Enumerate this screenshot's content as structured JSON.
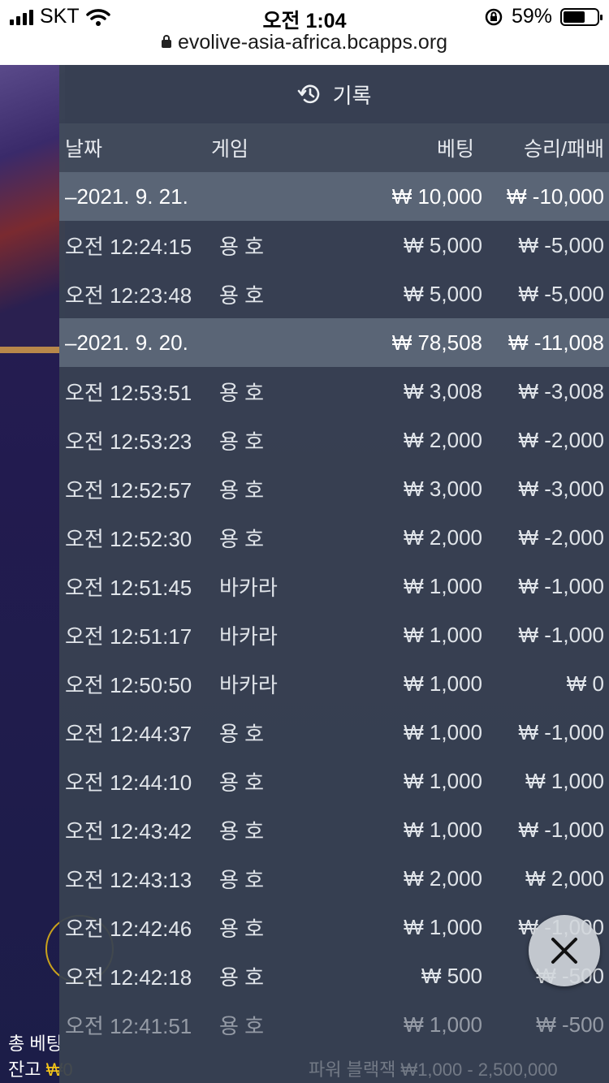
{
  "status_bar": {
    "carrier": "SKT",
    "time": "오전 1:04",
    "battery": "59%",
    "url": "evolive-asia-africa.bcapps.org"
  },
  "panel": {
    "title": "기록",
    "columns": {
      "date": "날짜",
      "game": "게임",
      "bet": "베팅",
      "winloss": "승리/패배"
    },
    "groups": [
      {
        "date": "–2021. 9. 21.",
        "bet": "₩ 10,000",
        "winloss": "₩ -10,000",
        "rows": [
          {
            "time": "오전 12:24:15",
            "game": "용 호",
            "bet": "₩ 5,000",
            "winloss": "₩ -5,000"
          },
          {
            "time": "오전 12:23:48",
            "game": "용 호",
            "bet": "₩ 5,000",
            "winloss": "₩ -5,000"
          }
        ]
      },
      {
        "date": "–2021. 9. 20.",
        "bet": "₩ 78,508",
        "winloss": "₩ -11,008",
        "rows": [
          {
            "time": "오전 12:53:51",
            "game": "용 호",
            "bet": "₩ 3,008",
            "winloss": "₩ -3,008"
          },
          {
            "time": "오전 12:53:23",
            "game": "용 호",
            "bet": "₩ 2,000",
            "winloss": "₩ -2,000"
          },
          {
            "time": "오전 12:52:57",
            "game": "용 호",
            "bet": "₩ 3,000",
            "winloss": "₩ -3,000"
          },
          {
            "time": "오전 12:52:30",
            "game": "용 호",
            "bet": "₩ 2,000",
            "winloss": "₩ -2,000"
          },
          {
            "time": "오전 12:51:45",
            "game": "바카라",
            "bet": "₩ 1,000",
            "winloss": "₩ -1,000"
          },
          {
            "time": "오전 12:51:17",
            "game": "바카라",
            "bet": "₩ 1,000",
            "winloss": "₩ -1,000"
          },
          {
            "time": "오전 12:50:50",
            "game": "바카라",
            "bet": "₩ 1,000",
            "winloss": "₩ 0"
          },
          {
            "time": "오전 12:44:37",
            "game": "용 호",
            "bet": "₩ 1,000",
            "winloss": "₩ -1,000"
          },
          {
            "time": "오전 12:44:10",
            "game": "용 호",
            "bet": "₩ 1,000",
            "winloss": "₩ 1,000"
          },
          {
            "time": "오전 12:43:42",
            "game": "용 호",
            "bet": "₩ 1,000",
            "winloss": "₩ -1,000"
          },
          {
            "time": "오전 12:43:13",
            "game": "용 호",
            "bet": "₩ 2,000",
            "winloss": "₩ 2,000"
          },
          {
            "time": "오전 12:42:46",
            "game": "용 호",
            "bet": "₩ 1,000",
            "winloss": "₩ -1,000"
          },
          {
            "time": "오전 12:42:18",
            "game": "용 호",
            "bet": "₩ 500",
            "winloss": "₩ -500"
          },
          {
            "time": "오전 12:41:51",
            "game": "용 호",
            "bet": "₩ 1,000",
            "winloss": "₩ -500"
          }
        ]
      }
    ]
  },
  "game_footer": {
    "total_bet_label": "총 베팅",
    "balance_label": "잔고",
    "balance_value": "₩0",
    "faded_text": "파워 블랙잭 ₩1,000 - 2,500,000"
  },
  "icons": [
    "signal-icon",
    "wifi-icon",
    "orientation-lock-icon",
    "battery-icon",
    "lock-icon",
    "history-icon",
    "close-icon"
  ]
}
